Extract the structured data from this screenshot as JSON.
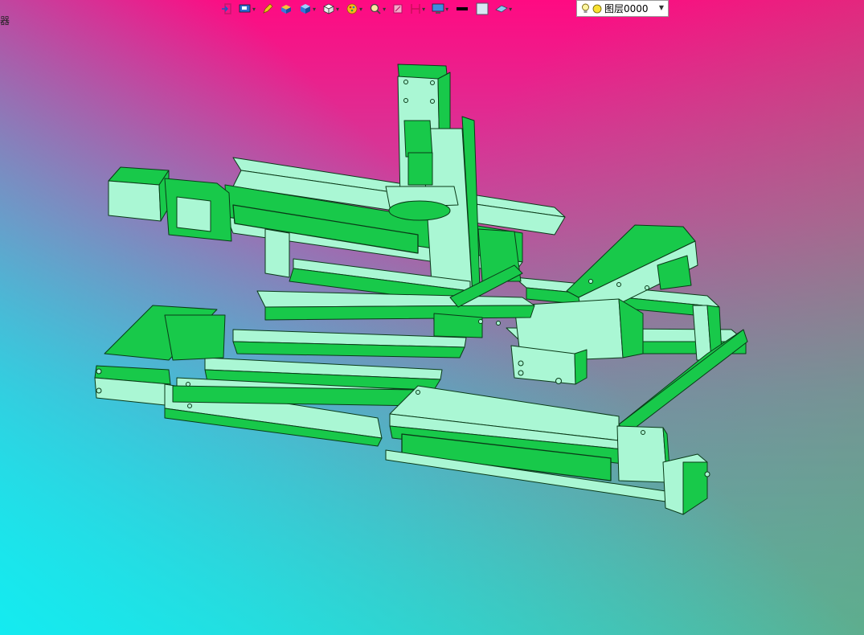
{
  "corner_label": "器",
  "toolbar": {
    "items": [
      {
        "name": "exit-sketch",
        "icon": "exit-icon"
      },
      {
        "name": "view-display",
        "icon": "display-icon",
        "dropdown": true
      },
      {
        "name": "pencil",
        "icon": "pencil-icon"
      },
      {
        "name": "shade",
        "icon": "shade-icon"
      },
      {
        "name": "render-style",
        "icon": "cube-shaded-icon",
        "dropdown": true
      },
      {
        "name": "view-orientation",
        "icon": "cube-icon",
        "dropdown": true
      },
      {
        "name": "appearance",
        "icon": "palette-icon",
        "dropdown": true
      },
      {
        "name": "zoom",
        "icon": "zoom-icon",
        "dropdown": true
      },
      {
        "name": "section",
        "icon": "section-icon"
      },
      {
        "name": "measure",
        "icon": "measure-icon",
        "dropdown": true
      },
      {
        "name": "monitor",
        "icon": "monitor-icon",
        "dropdown": true
      },
      {
        "name": "line-color",
        "icon": "line-color-icon"
      },
      {
        "name": "fill-color",
        "icon": "fill-color-icon"
      },
      {
        "name": "plane",
        "icon": "plane-icon",
        "dropdown": true
      }
    ],
    "layer": {
      "name": "图层0000",
      "icons": [
        "bulb-icon",
        "color-dot-icon"
      ]
    }
  },
  "colors": {
    "part_dark": "#18c94a",
    "part_light": "#aaf7d4",
    "outline": "#0a3a18",
    "bg_top": "#ff0a82",
    "bg_bottom": "#14ebf0"
  }
}
